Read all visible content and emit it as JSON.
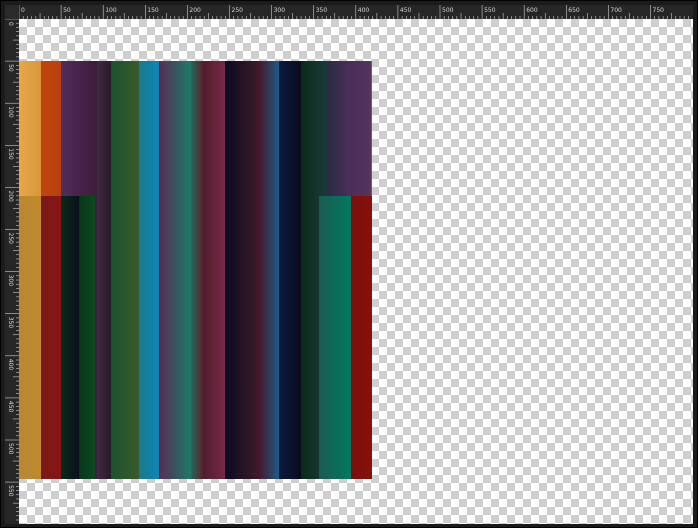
{
  "window": {
    "title": "",
    "ruler_color": "#262626",
    "checker_light": "#ffffff",
    "checker_dark": "#cfcfcf"
  },
  "rulers": {
    "horizontal_labels": [
      "0",
      "50",
      "100",
      "150",
      "200",
      "250",
      "300",
      "350",
      "400",
      "450",
      "500",
      "550",
      "600",
      "650",
      "700",
      "750"
    ],
    "vertical_labels": [
      "0",
      "50",
      "100",
      "150",
      "200",
      "250",
      "300",
      "350",
      "400",
      "450",
      "500",
      "550"
    ],
    "unit": "px"
  },
  "image": {
    "description_free": true,
    "stripes_top": [
      {
        "color_a": "#e8a84a",
        "color_b": "#d7963a"
      },
      {
        "color_a": "#c0440f",
        "color_b": "#b8400d"
      },
      {
        "color_a": "#502c5a",
        "color_b": "#3f1b3d"
      },
      {
        "color_a": "#3f2a3e",
        "color_b": "#2a1a2b"
      },
      {
        "color_a": "#1c5230",
        "color_b": "#3a5a2a"
      },
      {
        "color_a": "#1a7a8a",
        "color_b": "#0b86b6"
      },
      {
        "color_a": "#5a2a58",
        "color_b": "#1d7a68"
      },
      {
        "color_a": "#1d6a58",
        "color_b": "#5c1f2c"
      },
      {
        "color_a": "#4c1e2a",
        "color_b": "#7a2848"
      },
      {
        "color_a": "#0a0a20",
        "color_b": "#3a1a28"
      },
      {
        "color_a": "#4a1020",
        "color_b": "#1f5a88"
      },
      {
        "color_a": "#0b1a42",
        "color_b": "#0a0a1a"
      },
      {
        "color_a": "#0a2a18",
        "color_b": "#1a3a3a"
      },
      {
        "color_a": "#2a2a44",
        "color_b": "#4a3058"
      },
      {
        "color_a": "#4a2e58",
        "color_b": "#55335e"
      },
      {
        "color_a": "#c4420e",
        "color_b": "#b23a10"
      }
    ],
    "stripes_bottom": [
      {
        "color_a": "#b98834",
        "color_b": "#c08a2c"
      },
      {
        "color_a": "#7a1818",
        "color_b": "#8a1414"
      },
      {
        "color_a": "#0b2a1a",
        "color_b": "#08101a"
      },
      {
        "color_a": "#06361c",
        "color_b": "#0e4a1e"
      },
      {
        "color_a": "#1c5a52",
        "color_b": "#007a60"
      },
      {
        "color_a": "#7a1010",
        "color_b": "#8a1008"
      }
    ]
  }
}
